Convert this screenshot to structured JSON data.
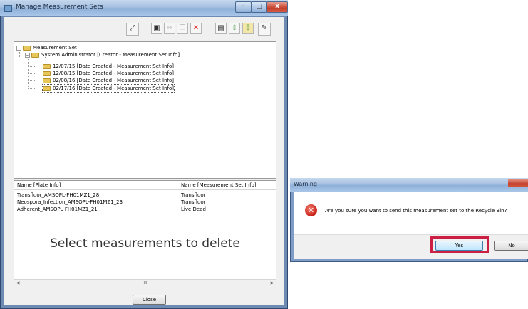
{
  "main_window": {
    "title": "Manage Measurement Sets",
    "close_glyph": "x",
    "toolbar": {
      "icons": [
        "fit-icon",
        "save-icon",
        "copy-rename-icon",
        "paste-icon",
        "delete-icon",
        "properties-icon",
        "export-icon",
        "import-icon",
        "settings-icon"
      ]
    },
    "tree": {
      "root": "Measurement Set",
      "creator": "System Administrator [Creator - Measurement Set Info]",
      "sets": [
        "12/07/15 [Date Created - Measurement Set Info]",
        "12/08/15 [Date Created - Measurement Set Info]",
        "02/08/16 [Date Created - Measurement Set Info]",
        "02/17/16 [Date Created - Measurement Set Info]"
      ]
    },
    "list": {
      "columns": [
        "Name [Plate Info]",
        "Name [Measurement Set Info]"
      ],
      "rows": [
        [
          "Transfluor_AMSOPL-FH01MZ1_28",
          "Transfluor"
        ],
        [
          "Neospora_Infection_AMSOPL-FH01MZ1_23",
          "Transfluor"
        ],
        [
          "Adherent_AMSOPL-FH01MZ1_21",
          "Live Dead"
        ]
      ],
      "overlay_text": "Select measurements to delete",
      "scroll_thumb": "III"
    },
    "close_label": "Close"
  },
  "warning_dialog": {
    "title": "Warning",
    "message": "Are you sure you want to send this measurement set to the Recycle Bin?",
    "yes_label": "Yes",
    "no_label": "No",
    "highlight_color": "#cc1f44"
  }
}
